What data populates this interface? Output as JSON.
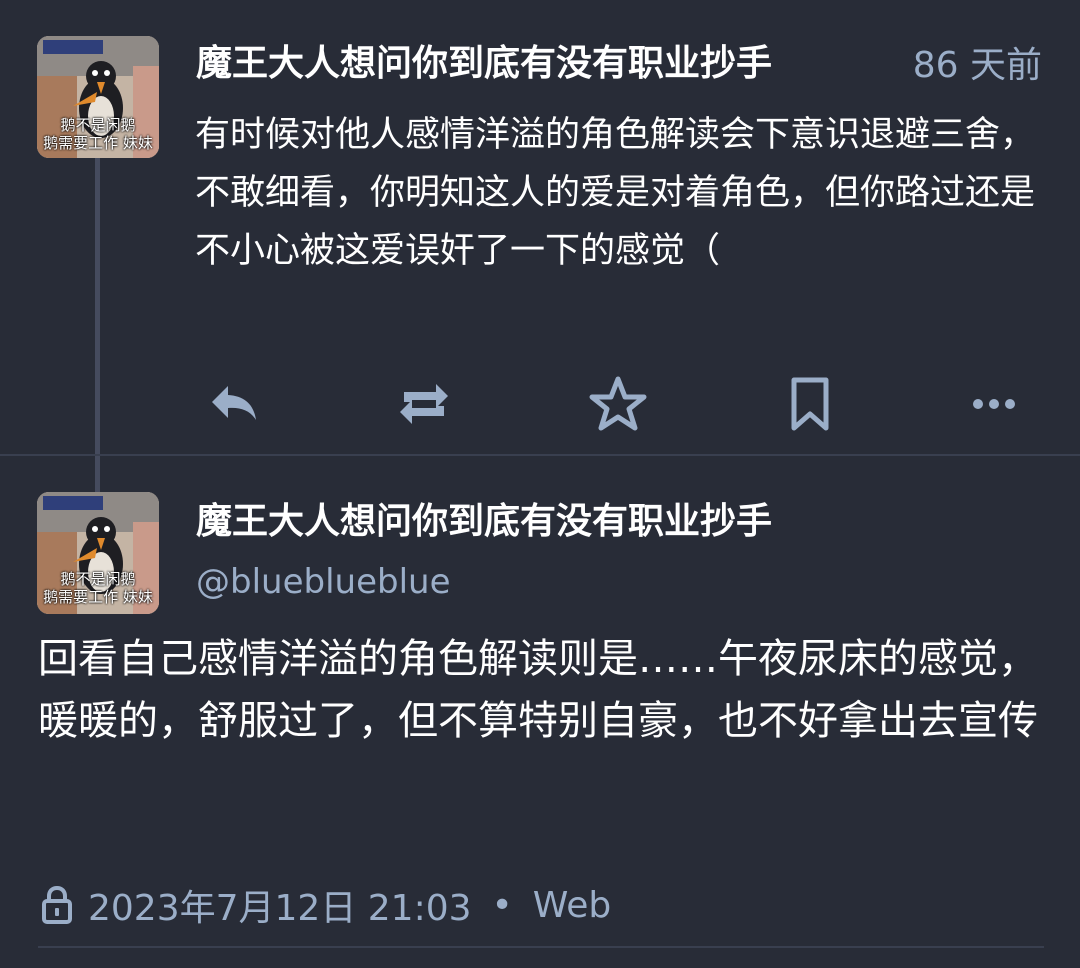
{
  "status_1": {
    "author": "魔王大人想问你到底有没有职业抄手",
    "relative_time": "86 天前",
    "avatar_caption": [
      "鹅不是闲鹅",
      "鹅需要工作 妹妹"
    ],
    "text": "有时候对他人感情洋溢的角色解读会下意识退避三舍，不敢细看，你明知这人的爱是对着角色，但你路过还是不小心被这爱误奸了一下的感觉（",
    "actions": {
      "reply_icon": "reply-icon",
      "boost_icon": "boost-icon",
      "favourite_icon": "star-icon",
      "bookmark_icon": "bookmark-icon",
      "more_icon": "more-icon"
    }
  },
  "status_2": {
    "author": "魔王大人想问你到底有没有职业抄手",
    "handle": "@blueblueblue",
    "avatar_caption": [
      "鹅不是闲鹅",
      "鹅需要工作 妹妹"
    ],
    "text": "回看自己感情洋溢的角色解读则是……午夜尿床的感觉，暖暖的，舒服过了，但不算特别自豪，也不好拿出去宣传",
    "meta": {
      "visibility_icon": "lock-icon",
      "datetime": "2023年7月12日 21:03",
      "separator": "•",
      "application": "Web"
    }
  },
  "colors": {
    "background": "#282c37",
    "secondary_text": "#9baec8",
    "primary_text": "#ffffff",
    "divider": "#393f4f"
  }
}
